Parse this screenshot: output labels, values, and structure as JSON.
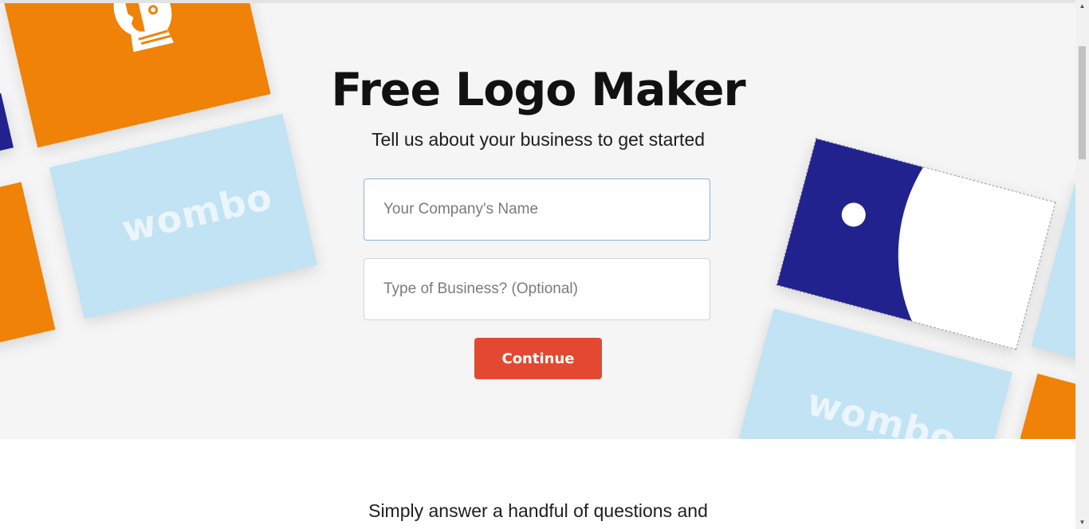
{
  "hero": {
    "title": "Free Logo Maker",
    "subtitle": "Tell us about your business to get started"
  },
  "form": {
    "company_placeholder": "Your Company's Name",
    "business_type_placeholder": "Type of Business? (Optional)",
    "continue_label": "Continue"
  },
  "decor": {
    "card_brand_text": "wombo",
    "icons": [
      "astronaut-logo-icon",
      "flower-logo-icon"
    ]
  },
  "section": {
    "intro_text": "Simply answer a handful of questions and"
  },
  "colors": {
    "orange": "#ef8207",
    "light_blue": "#c1e3f3",
    "navy": "#22228f",
    "button": "#e24930",
    "hero_bg": "#f5f5f5"
  }
}
